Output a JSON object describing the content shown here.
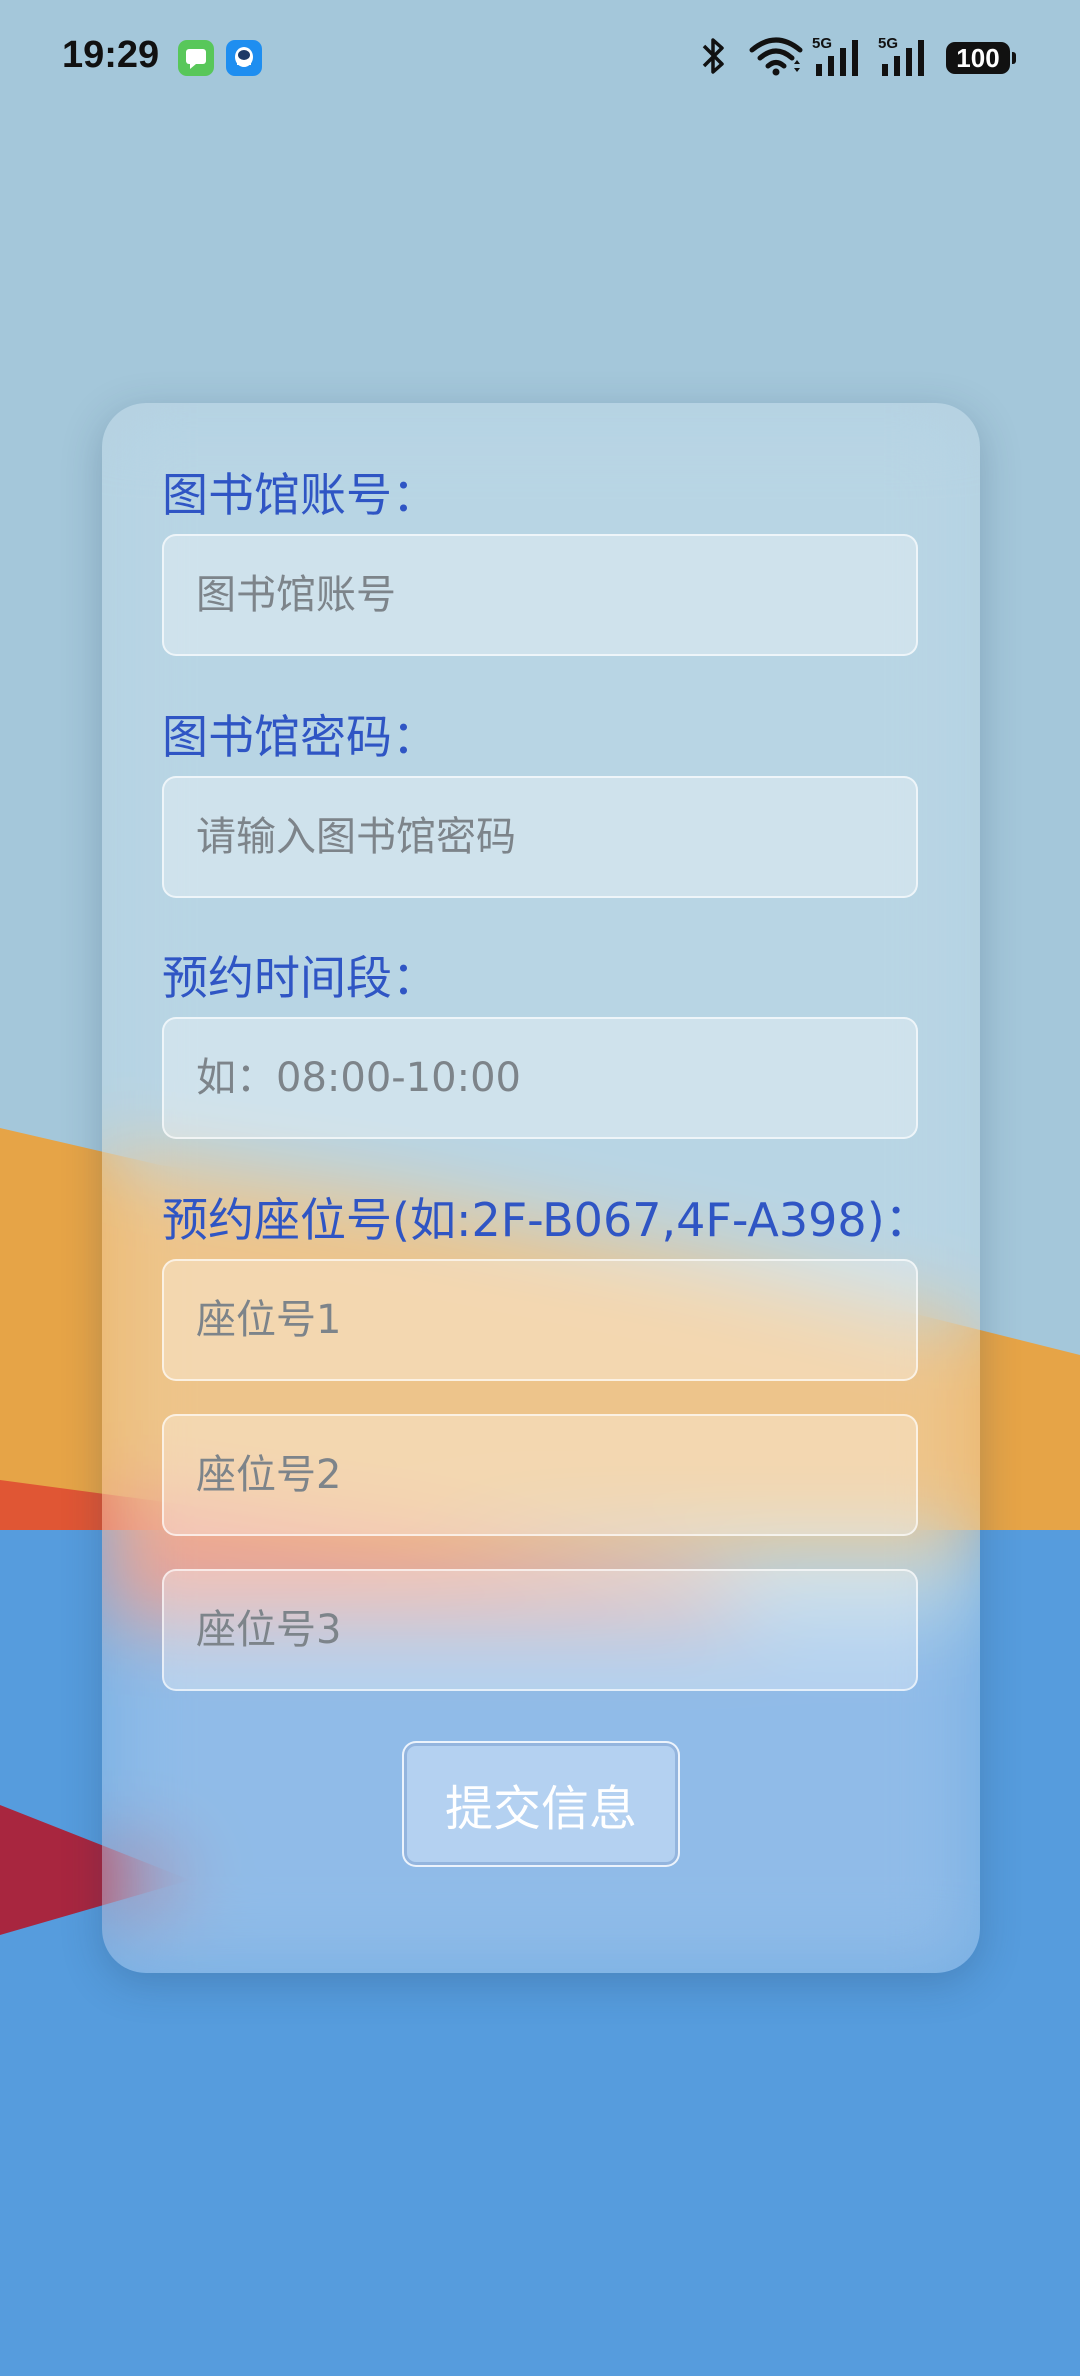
{
  "status_bar": {
    "time": "19:29",
    "icons": [
      "messages-app-icon",
      "qq-app-icon",
      "bluetooth-icon",
      "wifi-icon",
      "signal-5g-icon",
      "signal-5g-icon"
    ],
    "network_label_1": "5G",
    "network_label_2": "5G",
    "battery": "100"
  },
  "form": {
    "account_label": "图书馆账号：",
    "account_placeholder": "图书馆账号",
    "password_label": "图书馆密码：",
    "password_placeholder": "请输入图书馆密码",
    "time_label": "预约时间段：",
    "time_placeholder": "如：08:00-10:00",
    "seat_label": "预约座位号(如:2F-B067,4F-A398)：",
    "seat1_placeholder": "座位号1",
    "seat2_placeholder": "座位号2",
    "seat3_placeholder": "座位号3",
    "submit_label": "提交信息"
  },
  "colors": {
    "sky": "#a4c7da",
    "orange": "#e6a447",
    "red": "#e05634",
    "crimson": "#a8263f",
    "blue": "#569cdd",
    "label_blue": "#2f55c4"
  }
}
